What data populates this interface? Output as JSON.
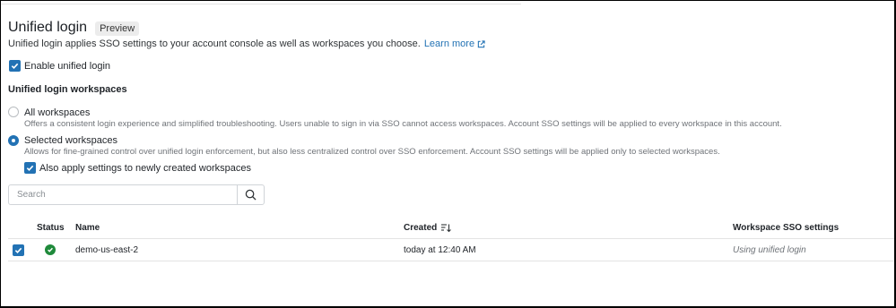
{
  "header": {
    "title": "Unified login",
    "badge": "Preview",
    "description": "Unified login applies SSO settings to your account console as well as workspaces you choose.",
    "learn_more": "Learn more"
  },
  "enable_checkbox": {
    "label": "Enable unified login",
    "checked": true
  },
  "workspaces_section": {
    "heading": "Unified login workspaces",
    "options": [
      {
        "label": "All workspaces",
        "description": "Offers a consistent login experience and simplified troubleshooting. Users unable to sign in via SSO cannot access workspaces. Account SSO settings will be applied to every workspace in this account.",
        "selected": false
      },
      {
        "label": "Selected workspaces",
        "description": "Allows for fine-grained control over unified login enforcement, but also less centralized control over SSO enforcement. Account SSO settings will be applied only to selected workspaces.",
        "selected": true
      }
    ],
    "also_apply": {
      "label": "Also apply settings to newly created workspaces",
      "checked": true
    }
  },
  "search": {
    "placeholder": "Search",
    "value": ""
  },
  "table": {
    "columns": {
      "status": "Status",
      "name": "Name",
      "created": "Created",
      "sso": "Workspace SSO settings"
    },
    "rows": [
      {
        "selected": true,
        "status": "ok",
        "name": "demo-us-east-2",
        "created": "today at 12:40 AM",
        "sso": "Using unified login"
      }
    ]
  },
  "colors": {
    "accent": "#2272b4",
    "status_ok": "#1f8a3b"
  }
}
